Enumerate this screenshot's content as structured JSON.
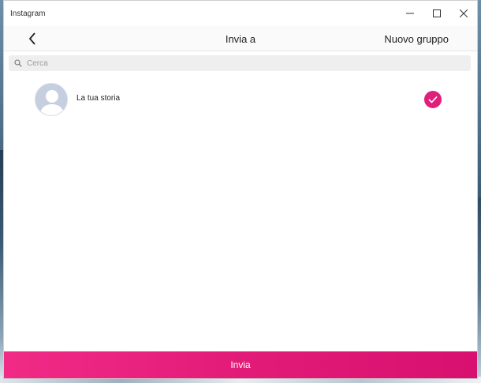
{
  "window": {
    "title": "Instagram"
  },
  "window_controls": {
    "minimize_icon": "minimize-icon",
    "maximize_icon": "maximize-icon",
    "close_icon": "close-icon"
  },
  "header": {
    "title": "Invia a",
    "new_group": "Nuovo gruppo",
    "back_icon": "chevron-left-icon"
  },
  "search": {
    "placeholder": "Cerca",
    "value": "",
    "icon": "search-icon"
  },
  "list": {
    "items": [
      {
        "label": "La tua storia",
        "avatar_icon": "default-avatar-icon",
        "selected": true
      }
    ]
  },
  "footer": {
    "send_label": "Invia"
  },
  "colors": {
    "accent": "#e01f7c",
    "button_gradient_start": "#f02b86",
    "button_gradient_end": "#d8106f"
  }
}
